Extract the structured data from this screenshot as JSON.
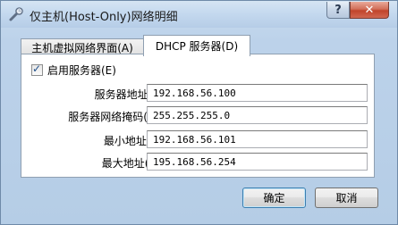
{
  "window": {
    "title": "仅主机(Host-Only)网络明细",
    "help_label": "?",
    "close_label": "✕"
  },
  "tabs": [
    {
      "label": "主机虚拟网络界面(A)"
    },
    {
      "label": "DHCP 服务器(D)"
    }
  ],
  "dhcp": {
    "enable_label": "启用服务器(E)",
    "enabled": true,
    "fields": [
      {
        "label": "服务器地址(r):",
        "value": "192.168.56.100"
      },
      {
        "label": "服务器网络掩码(M):",
        "value": "255.255.255.0"
      },
      {
        "label": "最小地址(L):",
        "value": "192.168.56.101"
      },
      {
        "label": "最大地址(U):",
        "value": "195.168.56.254"
      }
    ]
  },
  "buttons": {
    "ok_label": "确定",
    "cancel_label": "取消"
  }
}
